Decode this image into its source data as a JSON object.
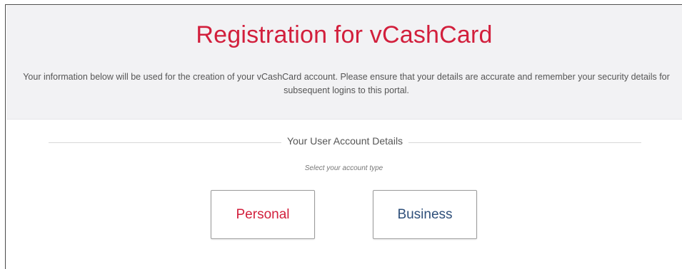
{
  "header": {
    "title": "Registration for vCashCard",
    "description": "Your information below will be used for the creation of your vCashCard account. Please ensure that your details are accurate and remember your security details for subsequent logins to this portal."
  },
  "account_section": {
    "heading": "Your User Account Details",
    "hint": "Select your account type",
    "options": [
      {
        "label": "Personal"
      },
      {
        "label": "Business"
      }
    ]
  },
  "colors": {
    "accent_red": "#d21f3c",
    "business_blue": "#2e4f7a",
    "header_background": "#f2f2f4"
  }
}
